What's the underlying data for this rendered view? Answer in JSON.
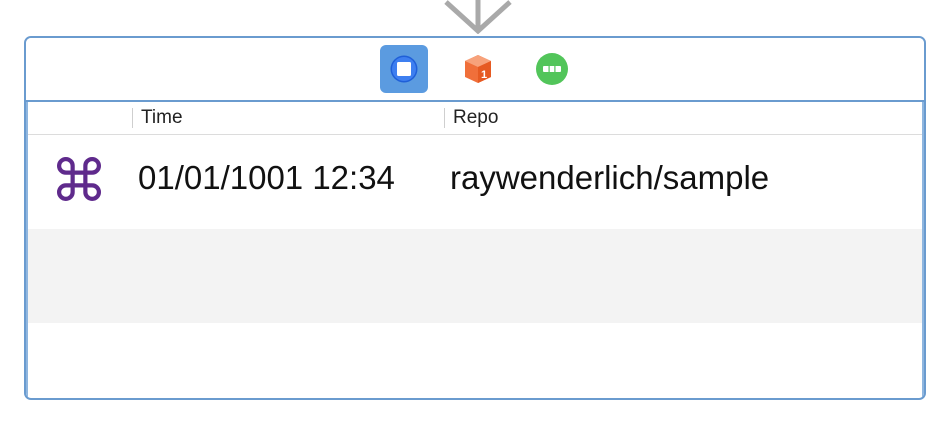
{
  "segue": {
    "icon": "segue-arrow-icon"
  },
  "scene_dock": {
    "icons": [
      {
        "name": "view-controller-icon",
        "selected": true,
        "color": "#5b9be0"
      },
      {
        "name": "first-responder-icon",
        "selected": false,
        "color": "#f06f3a"
      },
      {
        "name": "exit-icon",
        "selected": false,
        "color": "#52c55a"
      }
    ],
    "first_responder_badge": "1"
  },
  "table": {
    "columns": [
      {
        "label": ""
      },
      {
        "label": "Time"
      },
      {
        "label": "Repo"
      }
    ],
    "rows": [
      {
        "icon": "command-icon",
        "glyph": "⌘",
        "time": "01/01/1001 12:34",
        "repo": "raywenderlich/sample"
      },
      {
        "time": "",
        "repo": ""
      },
      {
        "time": "",
        "repo": ""
      }
    ]
  },
  "colors": {
    "scene_border": "#6a9bcf",
    "selected": "#5b9be0",
    "icon_purple": "#5f2a8c",
    "alt_row": "#f3f3f3"
  }
}
